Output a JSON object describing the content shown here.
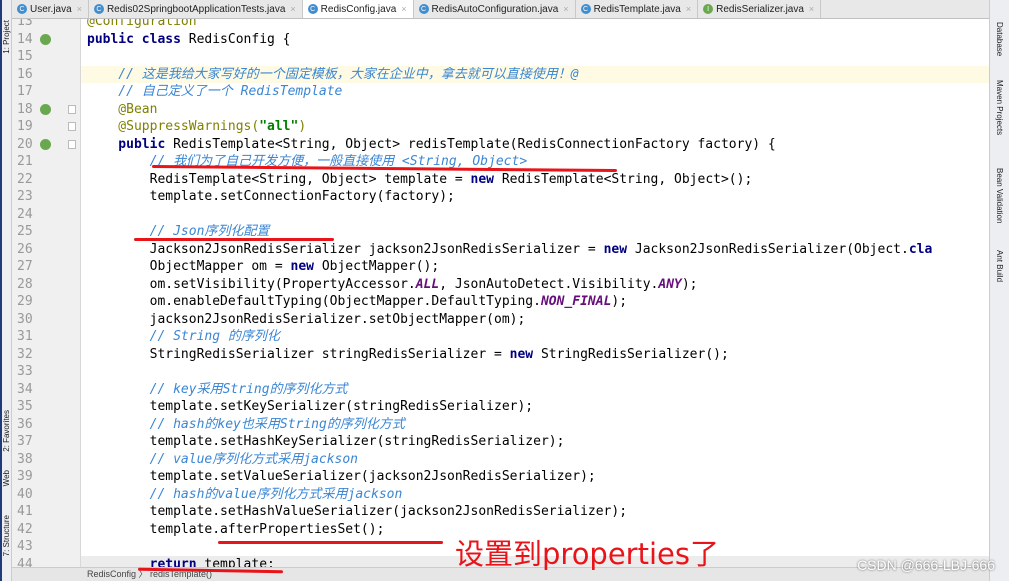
{
  "tabs": [
    {
      "label": "User.java",
      "icon": "C",
      "active": false
    },
    {
      "label": "Redis02SpringbootApplicationTests.java",
      "icon": "C",
      "active": false
    },
    {
      "label": "RedisConfig.java",
      "icon": "C",
      "active": true
    },
    {
      "label": "RedisAutoConfiguration.java",
      "icon": "C",
      "active": false
    },
    {
      "label": "RedisTemplate.java",
      "icon": "C",
      "active": false
    },
    {
      "label": "RedisSerializer.java",
      "icon": "I",
      "active": false
    }
  ],
  "left_tools": [
    "1: Project",
    "2: Favorites",
    "Web",
    "7: Structure"
  ],
  "right_tools": [
    "Database",
    "Maven Projects",
    "Bean Validation",
    "Ant Build"
  ],
  "breadcrumb": "RedisConfig  〉 redisTemplate()",
  "annotation_text": "设置到properties了",
  "watermark": "CSDN @666-LBJ-666",
  "current_line": 16,
  "code": {
    "lines": [
      {
        "n": "13",
        "tokens": [
          {
            "t": "an",
            "s": "@Configuration"
          }
        ]
      },
      {
        "n": "14",
        "tokens": [
          {
            "t": "kw",
            "s": "public class "
          },
          {
            "t": "tx",
            "s": "RedisConfig {"
          }
        ]
      },
      {
        "n": "15",
        "tokens": []
      },
      {
        "n": "16",
        "tokens": [
          {
            "t": "cm",
            "s": "    // 这是我给大家写好的一个固定模板，大家在企业中，拿去就可以直接使用！@"
          }
        ]
      },
      {
        "n": "17",
        "tokens": [
          {
            "t": "cm",
            "s": "    // 自己定义了一个 RedisTemplate"
          }
        ]
      },
      {
        "n": "18",
        "tokens": [
          {
            "t": "an",
            "s": "    @Bean"
          }
        ]
      },
      {
        "n": "19",
        "tokens": [
          {
            "t": "an",
            "s": "    @SuppressWarnings("
          },
          {
            "t": "str",
            "s": "\"all\""
          },
          {
            "t": "an",
            "s": ")"
          }
        ]
      },
      {
        "n": "20",
        "tokens": [
          {
            "t": "kw",
            "s": "    public "
          },
          {
            "t": "tx",
            "s": "RedisTemplate<String, Object> redisTemplate(RedisConnectionFactory factory) {"
          }
        ]
      },
      {
        "n": "21",
        "tokens": [
          {
            "t": "cm",
            "s": "        // 我们为了自己开发方便，一般直接使用 <String, Object>"
          }
        ]
      },
      {
        "n": "22",
        "tokens": [
          {
            "t": "tx",
            "s": "        RedisTemplate<String, Object> template = "
          },
          {
            "t": "kw",
            "s": "new "
          },
          {
            "t": "tx",
            "s": "RedisTemplate<String, Object>();"
          }
        ]
      },
      {
        "n": "23",
        "tokens": [
          {
            "t": "tx",
            "s": "        template.setConnectionFactory(factory);"
          }
        ]
      },
      {
        "n": "24",
        "tokens": []
      },
      {
        "n": "25",
        "tokens": [
          {
            "t": "cm",
            "s": "        // Json序列化配置"
          }
        ]
      },
      {
        "n": "26",
        "tokens": [
          {
            "t": "tx",
            "s": "        Jackson2JsonRedisSerializer jackson2JsonRedisSerializer = "
          },
          {
            "t": "kw",
            "s": "new "
          },
          {
            "t": "tx",
            "s": "Jackson2JsonRedisSerializer(Object."
          },
          {
            "t": "kw",
            "s": "cla"
          }
        ]
      },
      {
        "n": "27",
        "tokens": [
          {
            "t": "tx",
            "s": "        ObjectMapper om = "
          },
          {
            "t": "kw",
            "s": "new "
          },
          {
            "t": "tx",
            "s": "ObjectMapper();"
          }
        ]
      },
      {
        "n": "28",
        "tokens": [
          {
            "t": "tx",
            "s": "        om.setVisibility(PropertyAccessor."
          },
          {
            "t": "st",
            "s": "ALL"
          },
          {
            "t": "tx",
            "s": ", JsonAutoDetect.Visibility."
          },
          {
            "t": "st",
            "s": "ANY"
          },
          {
            "t": "tx",
            "s": ");"
          }
        ]
      },
      {
        "n": "29",
        "tokens": [
          {
            "t": "tx",
            "s": "        om.enableDefaultTyping(ObjectMapper.DefaultTyping."
          },
          {
            "t": "st",
            "s": "NON_FINAL"
          },
          {
            "t": "tx",
            "s": ");"
          }
        ]
      },
      {
        "n": "30",
        "tokens": [
          {
            "t": "tx",
            "s": "        jackson2JsonRedisSerializer.setObjectMapper(om);"
          }
        ]
      },
      {
        "n": "31",
        "tokens": [
          {
            "t": "cm",
            "s": "        // String 的序列化"
          }
        ]
      },
      {
        "n": "32",
        "tokens": [
          {
            "t": "tx",
            "s": "        StringRedisSerializer stringRedisSerializer = "
          },
          {
            "t": "kw",
            "s": "new "
          },
          {
            "t": "tx",
            "s": "StringRedisSerializer();"
          }
        ]
      },
      {
        "n": "33",
        "tokens": []
      },
      {
        "n": "34",
        "tokens": [
          {
            "t": "cm",
            "s": "        // key采用String的序列化方式"
          }
        ]
      },
      {
        "n": "35",
        "tokens": [
          {
            "t": "tx",
            "s": "        template.setKeySerializer(stringRedisSerializer);"
          }
        ]
      },
      {
        "n": "36",
        "tokens": [
          {
            "t": "cm",
            "s": "        // hash的key也采用String的序列化方式"
          }
        ]
      },
      {
        "n": "37",
        "tokens": [
          {
            "t": "tx",
            "s": "        template.setHashKeySerializer(stringRedisSerializer);"
          }
        ]
      },
      {
        "n": "38",
        "tokens": [
          {
            "t": "cm",
            "s": "        // value序列化方式采用jackson"
          }
        ]
      },
      {
        "n": "39",
        "tokens": [
          {
            "t": "tx",
            "s": "        template.setValueSerializer(jackson2JsonRedisSerializer);"
          }
        ]
      },
      {
        "n": "40",
        "tokens": [
          {
            "t": "cm",
            "s": "        // hash的value序列化方式采用jackson"
          }
        ]
      },
      {
        "n": "41",
        "tokens": [
          {
            "t": "tx",
            "s": "        template.setHashValueSerializer(jackson2JsonRedisSerializer);"
          }
        ]
      },
      {
        "n": "42",
        "tokens": [
          {
            "t": "tx",
            "s": "        template.afterPropertiesSet();"
          }
        ]
      },
      {
        "n": "43",
        "tokens": []
      },
      {
        "n": "44",
        "tokens": [
          {
            "t": "kw",
            "s": "        return "
          },
          {
            "t": "tx",
            "s": "template;"
          }
        ]
      }
    ]
  }
}
